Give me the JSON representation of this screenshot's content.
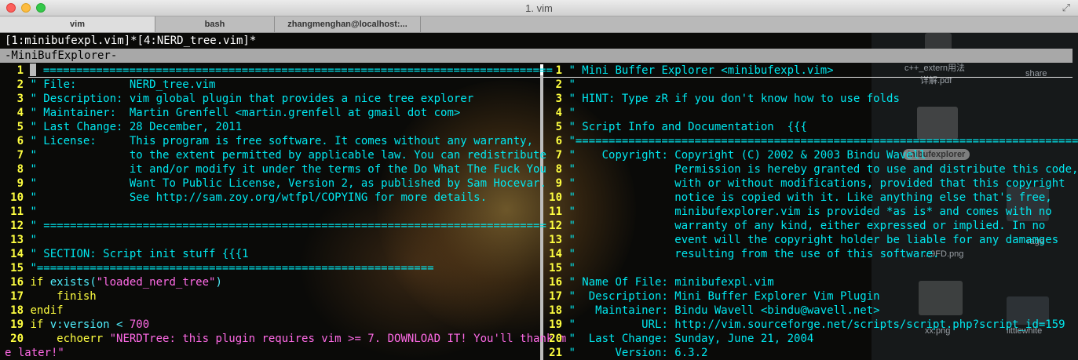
{
  "window": {
    "title": "1. vim"
  },
  "tabs": [
    {
      "label": "vim",
      "active": true
    },
    {
      "label": "bash",
      "active": false
    },
    {
      "label": "zhangmenghan@localhost:...",
      "active": false
    }
  ],
  "vim": {
    "buffer_line": "[1:minibufexpl.vim]*[4:NERD_tree.vim]*",
    "minibuf_title": "-MiniBufExplorer-"
  },
  "left_pane": {
    "lines": [
      {
        "n": "1",
        "text": " ============================================================================="
      },
      {
        "n": "2",
        "text": "\" File:        NERD_tree.vim"
      },
      {
        "n": "3",
        "text": "\" Description: vim global plugin that provides a nice tree explorer"
      },
      {
        "n": "4",
        "text": "\" Maintainer:  Martin Grenfell <martin.grenfell at gmail dot com>"
      },
      {
        "n": "5",
        "text": "\" Last Change: 28 December, 2011"
      },
      {
        "n": "6",
        "text": "\" License:     This program is free software. It comes without any warranty,"
      },
      {
        "n": "7",
        "text": "\"              to the extent permitted by applicable law. You can redistribute"
      },
      {
        "n": "8",
        "text": "\"              it and/or modify it under the terms of the Do What The Fuck You"
      },
      {
        "n": "9",
        "text": "\"              Want To Public License, Version 2, as published by Sam Hocevar."
      },
      {
        "n": "10",
        "text": "\"              See http://sam.zoy.org/wtfpl/COPYING for more details."
      },
      {
        "n": "11",
        "text": "\""
      },
      {
        "n": "12",
        "text": "\" ============================================================================"
      },
      {
        "n": "13",
        "text": "\""
      },
      {
        "n": "14",
        "text": "\" SECTION: Script init stuff {{{1"
      },
      {
        "n": "15",
        "text": "\"============================================================"
      }
    ],
    "code": {
      "l16": {
        "n": "16",
        "kw": "if",
        "fn": "exists",
        "open": "(",
        "str": "\"loaded_nerd_tree\"",
        "close": ")"
      },
      "l17": {
        "n": "17",
        "kw": "    finish"
      },
      "l18": {
        "n": "18",
        "kw": "endif"
      },
      "l19": {
        "n": "19",
        "kw": "if",
        "mid": " v:version < ",
        "num": "700"
      },
      "l20": {
        "n": "20",
        "kw": "    echoerr",
        "str": " \"NERDTree: this plugin requires vim >= 7. DOWNLOAD IT! You'll thank m"
      },
      "l20b": {
        "str": "e later!\""
      }
    }
  },
  "right_pane": {
    "lines": [
      {
        "n": "1",
        "text": "\" Mini Buffer Explorer <minibufexpl.vim>"
      },
      {
        "n": "2",
        "text": "\""
      },
      {
        "n": "3",
        "text": "\" HINT: Type zR if you don't know how to use folds"
      },
      {
        "n": "4",
        "text": "\""
      },
      {
        "n": "5",
        "text": "\" Script Info and Documentation  {{{"
      },
      {
        "n": "6",
        "text": "\"============================================================================="
      },
      {
        "n": "7",
        "text": "\"    Copyright: Copyright (C) 2002 & 2003 Bindu Wavell"
      },
      {
        "n": "8",
        "text": "\"               Permission is hereby granted to use and distribute this code,"
      },
      {
        "n": "9",
        "text": "\"               with or without modifications, provided that this copyright"
      },
      {
        "n": "10",
        "text": "\"               notice is copied with it. Like anything else that's free,"
      },
      {
        "n": "11",
        "text": "\"               minibufexplorer.vim is provided *as is* and comes with no"
      },
      {
        "n": "12",
        "text": "\"               warranty of any kind, either expressed or implied. In no"
      },
      {
        "n": "13",
        "text": "\"               event will the copyright holder be liable for any damamges"
      },
      {
        "n": "14",
        "text": "\"               resulting from the use of this software."
      },
      {
        "n": "15",
        "text": "\""
      },
      {
        "n": "16",
        "text": "\" Name Of File: minibufexpl.vim"
      },
      {
        "n": "17",
        "text": "\"  Description: Mini Buffer Explorer Vim Plugin"
      },
      {
        "n": "18",
        "text": "\"   Maintainer: Bindu Wavell <bindu@wavell.net>"
      },
      {
        "n": "19",
        "text": "\"          URL: http://vim.sourceforge.net/scripts/script.php?script_id=159"
      },
      {
        "n": "20",
        "text": "\"  Last Change: Sunday, June 21, 2004"
      },
      {
        "n": "21",
        "text": "\"      Version: 6.3.2"
      }
    ]
  },
  "desktop": {
    "labels": [
      "c++_extern用法",
      "详解.pdf",
      "share",
      "inibufexplorer",
      "...9FD.png",
      "rage",
      "xx.png",
      "littlewhite"
    ]
  }
}
